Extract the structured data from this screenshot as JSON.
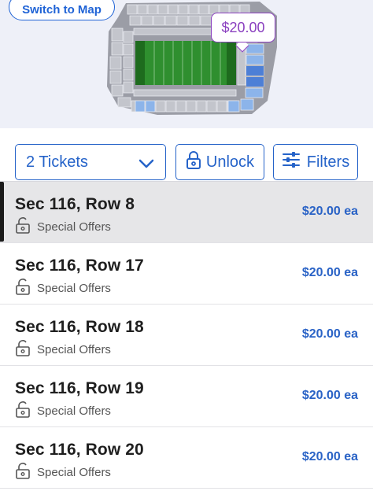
{
  "map": {
    "switch_label": "Switch to Map",
    "price_tag": "$20.00",
    "field_color": "#2f8f2f",
    "highlight_color": "#8cb4ea"
  },
  "filters": {
    "tickets_label": "2 Tickets",
    "unlock_label": "Unlock",
    "filters_label": "Filters"
  },
  "listings": [
    {
      "title": "Sec 116, Row 8",
      "offer": "Special Offers",
      "price": "$20.00 ea",
      "selected": true
    },
    {
      "title": "Sec 116, Row 17",
      "offer": "Special Offers",
      "price": "$20.00 ea",
      "selected": false
    },
    {
      "title": "Sec 116, Row 18",
      "offer": "Special Offers",
      "price": "$20.00 ea",
      "selected": false
    },
    {
      "title": "Sec 116, Row 19",
      "offer": "Special Offers",
      "price": "$20.00 ea",
      "selected": false
    },
    {
      "title": "Sec 116, Row 20",
      "offer": "Special Offers",
      "price": "$20.00 ea",
      "selected": false
    }
  ],
  "colors": {
    "accent_blue": "#2563c9",
    "price_purple": "#8a3fbf"
  }
}
